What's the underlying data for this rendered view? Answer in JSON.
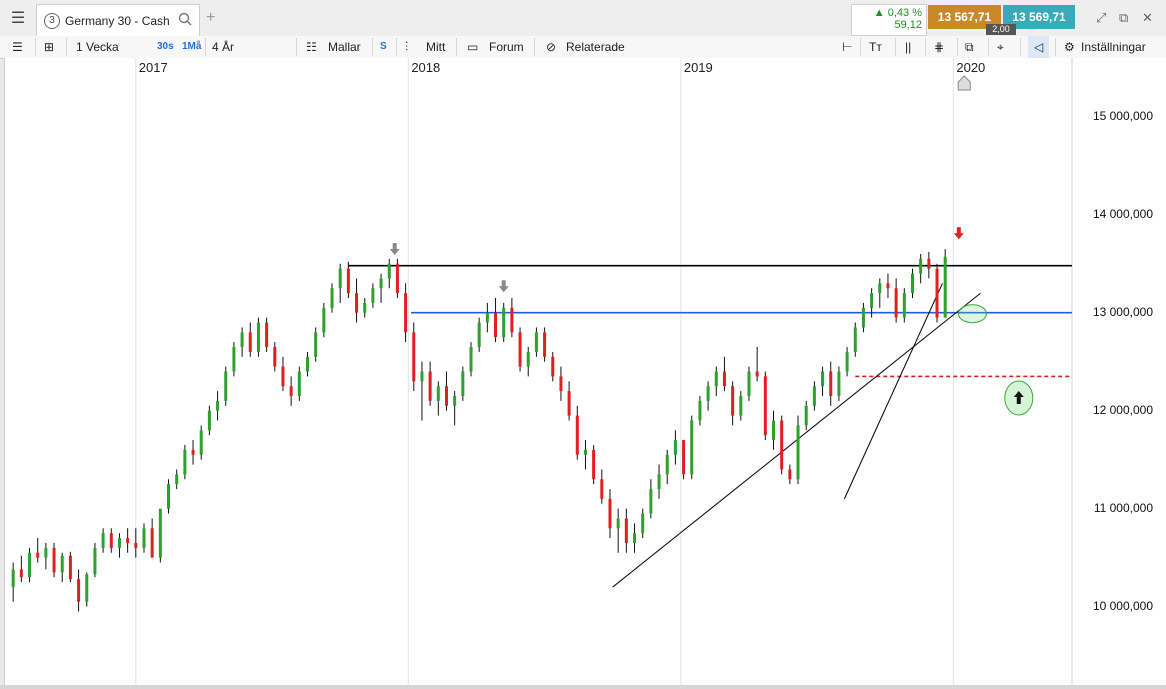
{
  "app": {
    "menu_icon": "hamburger-icon"
  },
  "tab": {
    "badge": "3",
    "title": "Germany 30 - Cash",
    "search_icon": "search-icon",
    "add_icon": "plus-icon"
  },
  "quote": {
    "change_pct": "▲ 0,43 %",
    "change_abs": "59,12",
    "bid": "13 567,71",
    "ask": "13 569,71",
    "spread": "2,00"
  },
  "window_icons": [
    "expand-icon",
    "popout-icon",
    "close-icon"
  ],
  "toolbar": {
    "period": "1 Vecka",
    "short1": "30s",
    "short2": "1Må",
    "range": "4 År",
    "templates": "Mallar",
    "s": "S",
    "mid": "Mitt",
    "forum": "Forum",
    "related": "Relaterade",
    "settings": "Inställningar"
  },
  "chart_data": {
    "type": "candlestick",
    "instrument": "Germany 30 - Cash",
    "x_labels": [
      "2017",
      "2018",
      "2019",
      "2020"
    ],
    "y_ticks": [
      "15 000,000",
      "14 000,000",
      "13 000,000",
      "12 000,000",
      "11 000,000",
      "10 000,000"
    ],
    "y_range": [
      9200,
      15600
    ],
    "candles": [
      [
        2016.55,
        10200,
        10450,
        10050,
        10380
      ],
      [
        2016.58,
        10380,
        10520,
        10250,
        10300
      ],
      [
        2016.61,
        10300,
        10600,
        10250,
        10550
      ],
      [
        2016.64,
        10550,
        10700,
        10450,
        10500
      ],
      [
        2016.67,
        10500,
        10650,
        10380,
        10600
      ],
      [
        2016.7,
        10600,
        10650,
        10300,
        10350
      ],
      [
        2016.73,
        10350,
        10550,
        10250,
        10520
      ],
      [
        2016.76,
        10520,
        10560,
        10250,
        10280
      ],
      [
        2016.79,
        10280,
        10380,
        9950,
        10050
      ],
      [
        2016.82,
        10050,
        10350,
        10000,
        10330
      ],
      [
        2016.85,
        10330,
        10650,
        10300,
        10600
      ],
      [
        2016.88,
        10600,
        10800,
        10550,
        10750
      ],
      [
        2016.91,
        10750,
        10800,
        10550,
        10600
      ],
      [
        2016.94,
        10600,
        10750,
        10500,
        10700
      ],
      [
        2016.97,
        10700,
        10800,
        10550,
        10650
      ],
      [
        2017.0,
        10650,
        10800,
        10500,
        10600
      ],
      [
        2017.03,
        10600,
        10850,
        10550,
        10800
      ],
      [
        2017.06,
        10800,
        10900,
        10550,
        10500
      ],
      [
        2017.09,
        10500,
        10950,
        10450,
        11000
      ],
      [
        2017.12,
        11000,
        11300,
        10950,
        11250
      ],
      [
        2017.15,
        11250,
        11400,
        11200,
        11350
      ],
      [
        2017.18,
        11350,
        11650,
        11300,
        11600
      ],
      [
        2017.21,
        11600,
        11700,
        11450,
        11550
      ],
      [
        2017.24,
        11550,
        11850,
        11500,
        11800
      ],
      [
        2017.27,
        11800,
        12050,
        11750,
        12000
      ],
      [
        2017.3,
        12000,
        12200,
        11900,
        12100
      ],
      [
        2017.33,
        12100,
        12450,
        12050,
        12400
      ],
      [
        2017.36,
        12400,
        12700,
        12350,
        12650
      ],
      [
        2017.39,
        12650,
        12850,
        12550,
        12800
      ],
      [
        2017.42,
        12800,
        12900,
        12550,
        12600
      ],
      [
        2017.45,
        12600,
        12950,
        12550,
        12900
      ],
      [
        2017.48,
        12900,
        12950,
        12600,
        12650
      ],
      [
        2017.51,
        12650,
        12700,
        12400,
        12450
      ],
      [
        2017.54,
        12450,
        12550,
        12200,
        12250
      ],
      [
        2017.57,
        12250,
        12350,
        12050,
        12150
      ],
      [
        2017.6,
        12150,
        12450,
        12100,
        12400
      ],
      [
        2017.63,
        12400,
        12600,
        12350,
        12550
      ],
      [
        2017.66,
        12550,
        12850,
        12500,
        12800
      ],
      [
        2017.69,
        12800,
        13100,
        12750,
        13050
      ],
      [
        2017.72,
        13050,
        13300,
        13000,
        13250
      ],
      [
        2017.75,
        13250,
        13500,
        13100,
        13450
      ],
      [
        2017.78,
        13450,
        13520,
        13150,
        13200
      ],
      [
        2017.81,
        13200,
        13350,
        12900,
        13000
      ],
      [
        2017.84,
        13000,
        13150,
        12950,
        13100
      ],
      [
        2017.87,
        13100,
        13300,
        13050,
        13250
      ],
      [
        2017.9,
        13250,
        13400,
        13100,
        13350
      ],
      [
        2017.93,
        13350,
        13550,
        13250,
        13500
      ],
      [
        2017.96,
        13500,
        13550,
        13150,
        13200
      ],
      [
        2017.99,
        13200,
        13300,
        12700,
        12800
      ],
      [
        2018.02,
        12800,
        12900,
        12200,
        12300
      ],
      [
        2018.05,
        12300,
        12500,
        11900,
        12400
      ],
      [
        2018.08,
        12400,
        12500,
        12050,
        12100
      ],
      [
        2018.11,
        12100,
        12300,
        11950,
        12250
      ],
      [
        2018.14,
        12250,
        12400,
        12000,
        12050
      ],
      [
        2018.17,
        12050,
        12200,
        11850,
        12150
      ],
      [
        2018.2,
        12150,
        12450,
        12100,
        12400
      ],
      [
        2018.23,
        12400,
        12700,
        12350,
        12650
      ],
      [
        2018.26,
        12650,
        12950,
        12600,
        12900
      ],
      [
        2018.29,
        12900,
        13100,
        12800,
        13000
      ],
      [
        2018.32,
        13000,
        13150,
        12700,
        12750
      ],
      [
        2018.35,
        12750,
        13100,
        12700,
        13050
      ],
      [
        2018.38,
        13050,
        13150,
        12750,
        12800
      ],
      [
        2018.41,
        12800,
        12850,
        12400,
        12450
      ],
      [
        2018.44,
        12450,
        12650,
        12350,
        12600
      ],
      [
        2018.47,
        12600,
        12850,
        12550,
        12800
      ],
      [
        2018.5,
        12800,
        12850,
        12500,
        12550
      ],
      [
        2018.53,
        12550,
        12600,
        12300,
        12350
      ],
      [
        2018.56,
        12350,
        12450,
        12100,
        12200
      ],
      [
        2018.59,
        12200,
        12300,
        11900,
        11950
      ],
      [
        2018.62,
        11950,
        12050,
        11500,
        11550
      ],
      [
        2018.65,
        11550,
        11700,
        11400,
        11600
      ],
      [
        2018.68,
        11600,
        11650,
        11250,
        11300
      ],
      [
        2018.71,
        11300,
        11400,
        11050,
        11100
      ],
      [
        2018.74,
        11100,
        11200,
        10700,
        10800
      ],
      [
        2018.77,
        10800,
        11000,
        10550,
        10900
      ],
      [
        2018.8,
        10900,
        11000,
        10550,
        10650
      ],
      [
        2018.83,
        10650,
        10850,
        10550,
        10750
      ],
      [
        2018.86,
        10750,
        11000,
        10700,
        10950
      ],
      [
        2018.89,
        10950,
        11300,
        10900,
        11200
      ],
      [
        2018.92,
        11200,
        11450,
        11100,
        11350
      ],
      [
        2018.95,
        11350,
        11600,
        11250,
        11550
      ],
      [
        2018.98,
        11550,
        11800,
        11450,
        11700
      ],
      [
        2019.01,
        11700,
        11700,
        11300,
        11350
      ],
      [
        2019.04,
        11350,
        11950,
        11300,
        11900
      ],
      [
        2019.07,
        11900,
        12150,
        11850,
        12100
      ],
      [
        2019.1,
        12100,
        12300,
        12000,
        12250
      ],
      [
        2019.13,
        12250,
        12450,
        12150,
        12400
      ],
      [
        2019.16,
        12400,
        12550,
        12200,
        12250
      ],
      [
        2019.19,
        12250,
        12300,
        11850,
        11950
      ],
      [
        2019.22,
        11950,
        12200,
        11900,
        12150
      ],
      [
        2019.25,
        12150,
        12450,
        12100,
        12400
      ],
      [
        2019.28,
        12400,
        12650,
        12300,
        12350
      ],
      [
        2019.31,
        12350,
        12400,
        11700,
        11750
      ],
      [
        2019.34,
        11700,
        12000,
        11600,
        11900
      ],
      [
        2019.37,
        11900,
        11950,
        11350,
        11400
      ],
      [
        2019.4,
        11400,
        11450,
        11250,
        11300
      ],
      [
        2019.43,
        11300,
        11950,
        11250,
        11850
      ],
      [
        2019.46,
        11850,
        12100,
        11800,
        12050
      ],
      [
        2019.49,
        12050,
        12300,
        12000,
        12250
      ],
      [
        2019.52,
        12250,
        12450,
        12150,
        12400
      ],
      [
        2019.55,
        12400,
        12500,
        12050,
        12150
      ],
      [
        2019.58,
        12150,
        12450,
        12100,
        12400
      ],
      [
        2019.61,
        12400,
        12650,
        12350,
        12600
      ],
      [
        2019.64,
        12600,
        12900,
        12550,
        12850
      ],
      [
        2019.67,
        12850,
        13100,
        12800,
        13050
      ],
      [
        2019.7,
        13050,
        13250,
        12950,
        13200
      ],
      [
        2019.73,
        13200,
        13350,
        13050,
        13300
      ],
      [
        2019.76,
        13300,
        13400,
        13150,
        13250
      ],
      [
        2019.79,
        13250,
        13350,
        12900,
        12950
      ],
      [
        2019.82,
        12950,
        13250,
        12900,
        13200
      ],
      [
        2019.85,
        13200,
        13450,
        13150,
        13400
      ],
      [
        2019.88,
        13400,
        13600,
        13300,
        13550
      ],
      [
        2019.91,
        13550,
        13620,
        13350,
        13450
      ],
      [
        2019.94,
        13450,
        13500,
        12900,
        12950
      ],
      [
        2019.97,
        12950,
        13650,
        12950,
        13570
      ]
    ],
    "annotations": {
      "resistance": 13480,
      "support_blue": 13000,
      "support_red_dashed": 12350,
      "arrow_markers": [
        "grey-down-arrow-2017-end",
        "grey-down-arrow-2018-mid",
        "red-down-arrow-2020",
        "up-arrow-target"
      ],
      "trendlines": [
        [
          2018.75,
          10200,
          2020.1,
          13200
        ],
        [
          2019.6,
          11100,
          2019.96,
          13300
        ]
      ]
    }
  },
  "colors": {
    "up": "#2ea02e",
    "down": "#e02020",
    "resistance": "#000000",
    "support": "#1f5ee0",
    "dashed": "#d62020",
    "bid": "#c8892b",
    "ask": "#3aa9b8"
  }
}
